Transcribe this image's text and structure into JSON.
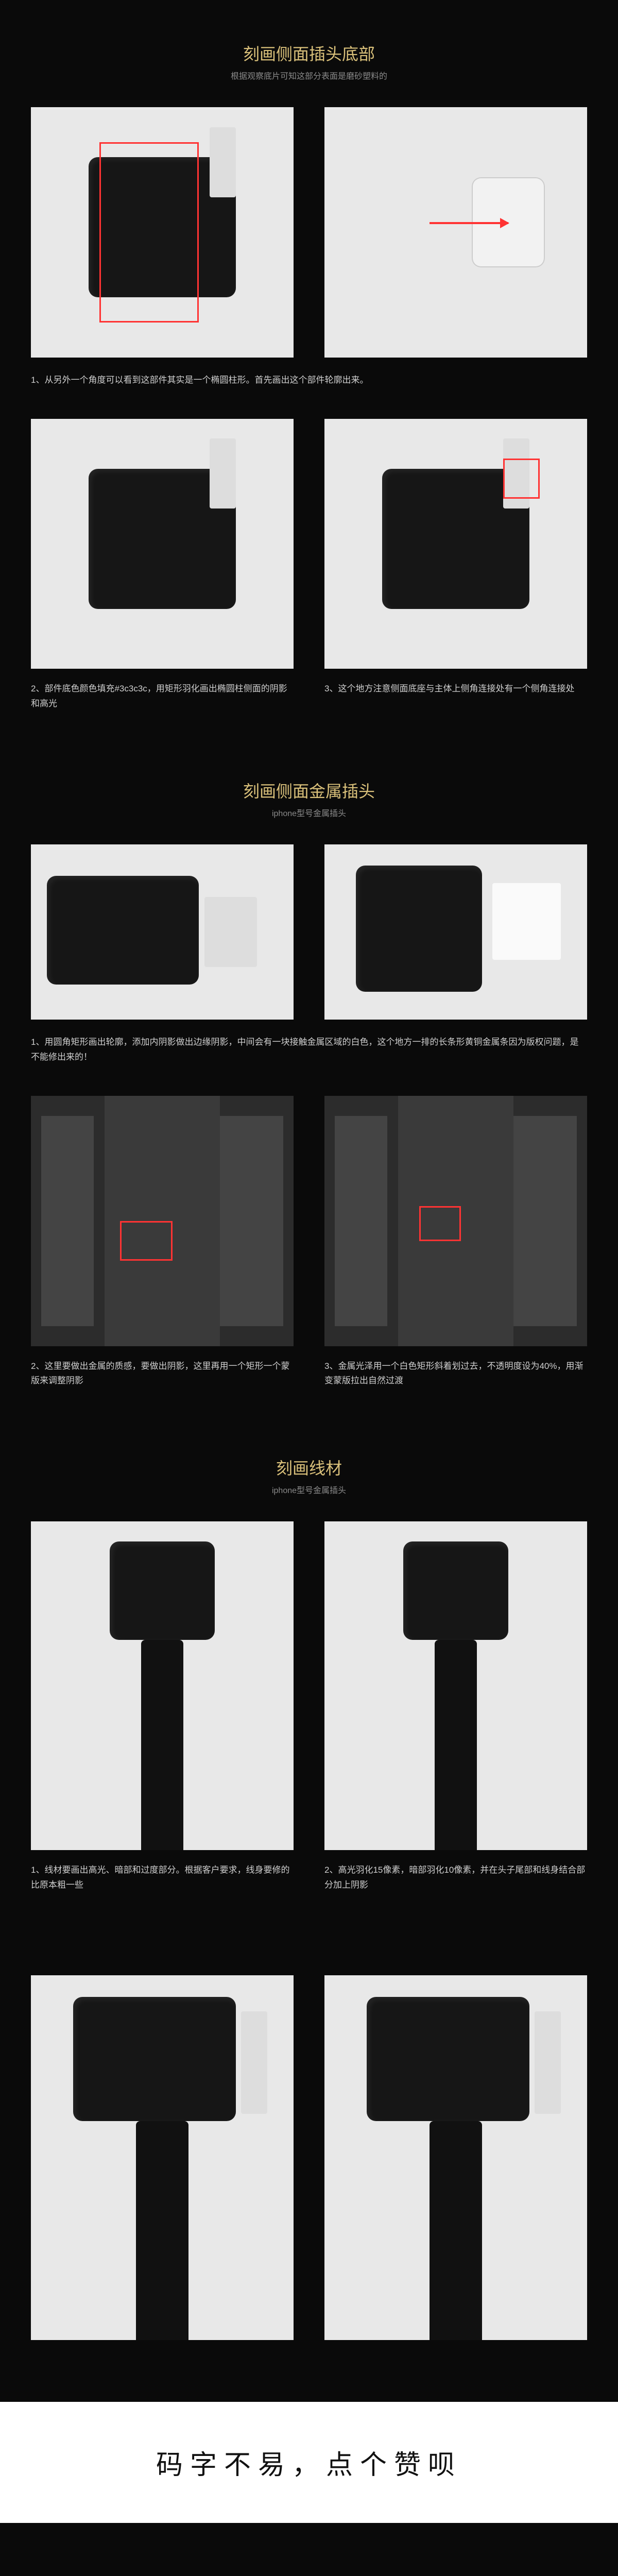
{
  "section1": {
    "title": "刻画侧面插头底部",
    "sub": "根据观察底片可知这部分表面是磨砂塑料的",
    "cap_full": "1、从另外一个角度可以看到这部件其实是一个椭圆柱形。首先画出这个部件轮廓出来。",
    "cap2": "2、部件底色颜色填充#3c3c3c，用矩形羽化画出椭圆柱侧面的阴影和高光",
    "cap3": "3、这个地方注意侧面底座与主体上侧角连接处有一个侧角连接处"
  },
  "section2": {
    "title": "刻画侧面金属插头",
    "sub": "iphone型号金属插头",
    "cap_full": "1、用圆角矩形画出轮廓，添加内阴影做出边缘阴影，中间会有一块接触金属区域的白色，这个地方一排的长条形黄铜金属条因为版权问题，是不能修出来的！",
    "cap2": "2、这里要做出金属的质感，要做出阴影，这里再用一个矩形一个蒙版来调整阴影",
    "cap3": "3、金属光泽用一个白色矩形斜着划过去，不透明度设为40%，用渐变蒙版拉出自然过渡"
  },
  "section3": {
    "title": "刻画线材",
    "sub": "iphone型号金属插头",
    "cap1": "1、线材要画出高光、暗部和过度部分。根据客户要求，线身要修的比原本粗一些",
    "cap2": "2、高光羽化15像素，暗部羽化10像素，并在头子尾部和线身结合部分加上阴影"
  },
  "footer": "码字不易，点个赞呗"
}
